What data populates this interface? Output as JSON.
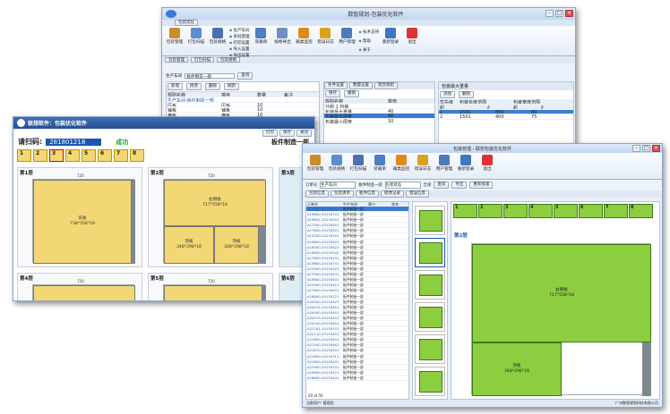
{
  "win1": {
    "title": "数智规划-包装优化软件",
    "tab": "包装优化",
    "ribbon": [
      {
        "label": "包装管理",
        "color": "#c98e2b"
      },
      {
        "label": "打包扫描",
        "color": "#5b8ecf"
      },
      {
        "label": "包装规格",
        "color": "#4b6fb0"
      },
      {
        "label": "装箱单",
        "color": "#4c7fc4"
      },
      {
        "label": "规格导出",
        "color": "#6f8fbf"
      },
      {
        "label": "箱类监控",
        "color": "#e08a1c"
      },
      {
        "label": "错误日志",
        "color": "#d7a31c"
      },
      {
        "label": "用户管理",
        "color": "#4e7bb8"
      },
      {
        "label": "重新登录",
        "color": "#3f77c2"
      },
      {
        "label": "退出",
        "color": "#d33"
      }
    ],
    "group_items": [
      "生产车间",
      "条码管理",
      "打印设置",
      "导入设置",
      "导出设置"
    ],
    "about_items": [
      "技术支持",
      "帮助",
      "关于"
    ],
    "caps": [
      "包装优化",
      "规则设置",
      "监控",
      "用户",
      "关于",
      "退出"
    ],
    "subtabs": [
      "包装管理",
      "打包扫描",
      "包装规格"
    ],
    "filter_label": "生产车间",
    "filter_value": "板件制造一部",
    "filter_btn": "查询",
    "toolbar": [
      "新增",
      "修改",
      "删除",
      "刷新"
    ],
    "table_head": [
      "规则名称",
      "排序",
      "数量",
      "备注"
    ],
    "tree_root": "生产车间-板件制造一部",
    "rows": [
      [
        "压板",
        "压板",
        "10"
      ],
      [
        "铺板",
        "铺板",
        "10"
      ],
      [
        "横板",
        "横板",
        "10"
      ],
      [
        "竖板",
        "竖板",
        "10"
      ],
      [
        "背板",
        "背板",
        "10"
      ]
    ],
    "mid_tabs": [
      "条件设置",
      "数量设置",
      "组合规则"
    ],
    "mid_toolbar": [
      "保存",
      "撤销"
    ],
    "mid_head": [
      "规则名称",
      "数值"
    ],
    "mid_rows": [
      [
        "分组 1 包装",
        "",
        ""
      ],
      [
        "包装最大重量",
        "40"
      ],
      [
        "包装最大厚度",
        "90"
      ],
      [
        "包装最小厚度",
        "10"
      ]
    ],
    "right_title": "包装最大重量",
    "right_toolbar": [
      "添加",
      "删除"
    ],
    "right_head": [
      "优先级",
      "包装长度范围",
      "包装宽度范围"
    ],
    "right_sub": [
      "起",
      "止",
      "起",
      "止"
    ],
    "right_rows": [
      [
        "1",
        "1501",
        "800",
        "80"
      ],
      [
        "2",
        "1501",
        "400",
        "75"
      ]
    ]
  },
  "win2": {
    "title": "联想软件：包装优化软件",
    "toolbar": [
      "打印",
      "保存",
      "关闭"
    ],
    "scan_label": "请扫码:",
    "scan_value": "281801218",
    "scan_status": "成功",
    "workshop": "板件制造一部",
    "slots": [
      {
        "n": "1",
        "sel": false
      },
      {
        "n": "2",
        "sel": false
      },
      {
        "n": "3",
        "sel": true
      },
      {
        "n": "4",
        "sel": false
      },
      {
        "n": "5",
        "sel": false
      },
      {
        "n": "6",
        "sel": false
      },
      {
        "n": "7",
        "sel": false
      },
      {
        "n": "8",
        "sel": false
      }
    ],
    "layers": [
      {
        "label": "第1层",
        "pieces": [
          {
            "name": "背板",
            "dim": "738*558*18"
          }
        ]
      },
      {
        "label": "第2层",
        "pieces": [
          {
            "name": "右侧板",
            "dim": "717*558*18"
          },
          {
            "name": "顶板",
            "dim": "348*298*18"
          },
          {
            "name": "顶板",
            "dim": "348*298*18"
          }
        ]
      },
      {
        "label": "第3层",
        "pieces": []
      },
      {
        "label": "第4层",
        "pieces": [
          {
            "name": "背板",
            "dim": "717*558*18"
          },
          {
            "name": "底层",
            "dim": "330*288*18"
          },
          {
            "name": "底层",
            "dim": "330*288*18"
          }
        ]
      },
      {
        "label": "第5层",
        "pieces": [
          {
            "name": "右侧板",
            "dim": "300*667*18"
          }
        ]
      },
      {
        "label": "第6层",
        "pieces": []
      }
    ],
    "dims": [
      "720",
      "558"
    ]
  },
  "win3": {
    "title": "包装管理 - 联想包装优化软件",
    "ribbon": [
      {
        "label": "包装管理",
        "color": "#c98e2b"
      },
      {
        "label": "包装规格",
        "color": "#5b8ecf"
      },
      {
        "label": "打包扫描",
        "color": "#4b6fb0"
      },
      {
        "label": "装箱单",
        "color": "#4c7fc4"
      },
      {
        "label": "箱类监控",
        "color": "#e08a1c"
      },
      {
        "label": "错误日志",
        "color": "#d7a31c"
      },
      {
        "label": "用户管理",
        "color": "#4e7bb8"
      },
      {
        "label": "重新登录",
        "color": "#3f77c2"
      },
      {
        "label": "退出",
        "color": "#d33"
      }
    ],
    "filter": [
      "订单号",
      "生产车间",
      "板件制造一部",
      "包装状态",
      "全部",
      "查询",
      "导出",
      "重新排版"
    ],
    "tabs": [
      "包装信息",
      "包装清单",
      "板件信息",
      "修改记录",
      "错误信息"
    ],
    "list_head": [
      "订单号",
      "生产车间",
      "客户",
      "状态"
    ],
    "list_rows": [
      "A19800-20130801",
      "A19800-20130741",
      "A19801-20130301",
      "A17500-20130301",
      "A17800-20130321",
      "A15200-20130301",
      "A15600-20130423",
      "A16500-20130422",
      "A19800-20130342",
      "A17800-20130431",
      "A19800-20130741",
      "A15900-20130423",
      "A17500-20130431",
      "A19800-20130501",
      "A15900-20130421",
      "A17800-20130501",
      "A19800-20130121",
      "A20000-20130423",
      "A20011-20130451",
      "A20000-20130501",
      "A20013-20130451",
      "A22240-20130451",
      "A22181-20130701",
      "A22110-20130451",
      "A21850-20130401",
      "A21500-20130461",
      "A21610-20130501",
      "A21850-20130311",
      "A21600-20130431",
      "A22500-20130331",
      "A19800-20130421",
      "A18800-20130441"
    ],
    "pager": "20 of 50",
    "layer_label": "第2层",
    "piece_main": {
      "name": "右侧板",
      "dim": "717*558*18"
    },
    "piece_sub": {
      "name": "顶板",
      "dim": "348*298*18"
    },
    "slots": [
      "1",
      "2",
      "3",
      "4",
      "5",
      "6",
      "7",
      "8"
    ],
    "status": "广州数智规划科技有限公司",
    "status_left": "当前用户: 管理员"
  },
  "colors": {
    "piece": "#f3d774",
    "green": "#8cce3f",
    "accent": "#1a56b0"
  }
}
